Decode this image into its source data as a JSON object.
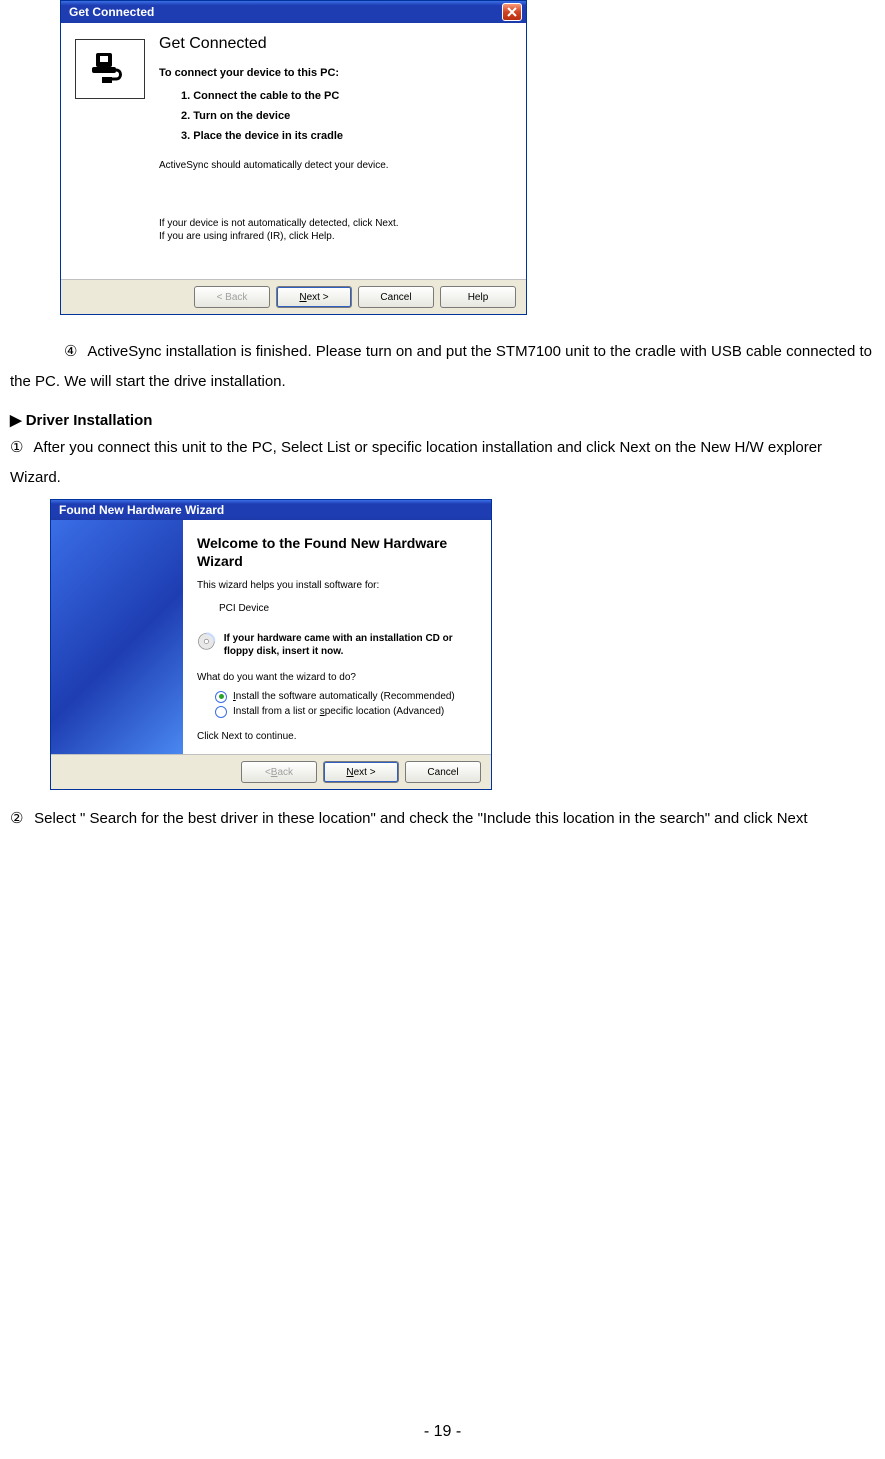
{
  "dialog1": {
    "title": "Get Connected",
    "heading": "Get Connected",
    "subhead": "To connect your device to this PC:",
    "steps": [
      "1.  Connect the cable to the PC",
      "2.  Turn on the device",
      "3.  Place the device in its cradle"
    ],
    "note1": "ActiveSync should automatically detect your device.",
    "note2a": "If your device is not automatically detected, click Next.",
    "note2b": "If you are using infrared (IR), click Help.",
    "buttons": {
      "back": "< Back",
      "next": "Next >",
      "cancel": "Cancel",
      "help": "Help"
    }
  },
  "doc": {
    "step4_num": "④",
    "step4": "ActiveSync installation is finished. Please turn on and put the STM7100 unit to the cradle with USB cable connected to the PC. We will start the drive installation.",
    "driver_head": "▶ Driver Installation",
    "drv1_num": "①",
    "drv1": "After you connect this unit to the PC, Select List or specific location installation and click Next on the New H/W explorer Wizard.",
    "drv2_num": "②",
    "drv2": "Select \" Search for the best driver in these location\" and check the \"Include this location in the search\" and click Next",
    "page_number": "- 19 -"
  },
  "dialog2": {
    "title": "Found New Hardware Wizard",
    "heading": "Welcome to the Found New Hardware Wizard",
    "intro": "This wizard helps you install software for:",
    "device": "PCI Device",
    "cd_text": "If your hardware came with an installation CD or floppy disk, insert it now.",
    "question": "What do you want the wizard to do?",
    "opt1": "Install the software automatically (Recommended)",
    "opt2": "Install from a list or specific location (Advanced)",
    "cont": "Click Next to continue.",
    "buttons": {
      "back": "< Back",
      "next": "Next >",
      "cancel": "Cancel"
    }
  }
}
